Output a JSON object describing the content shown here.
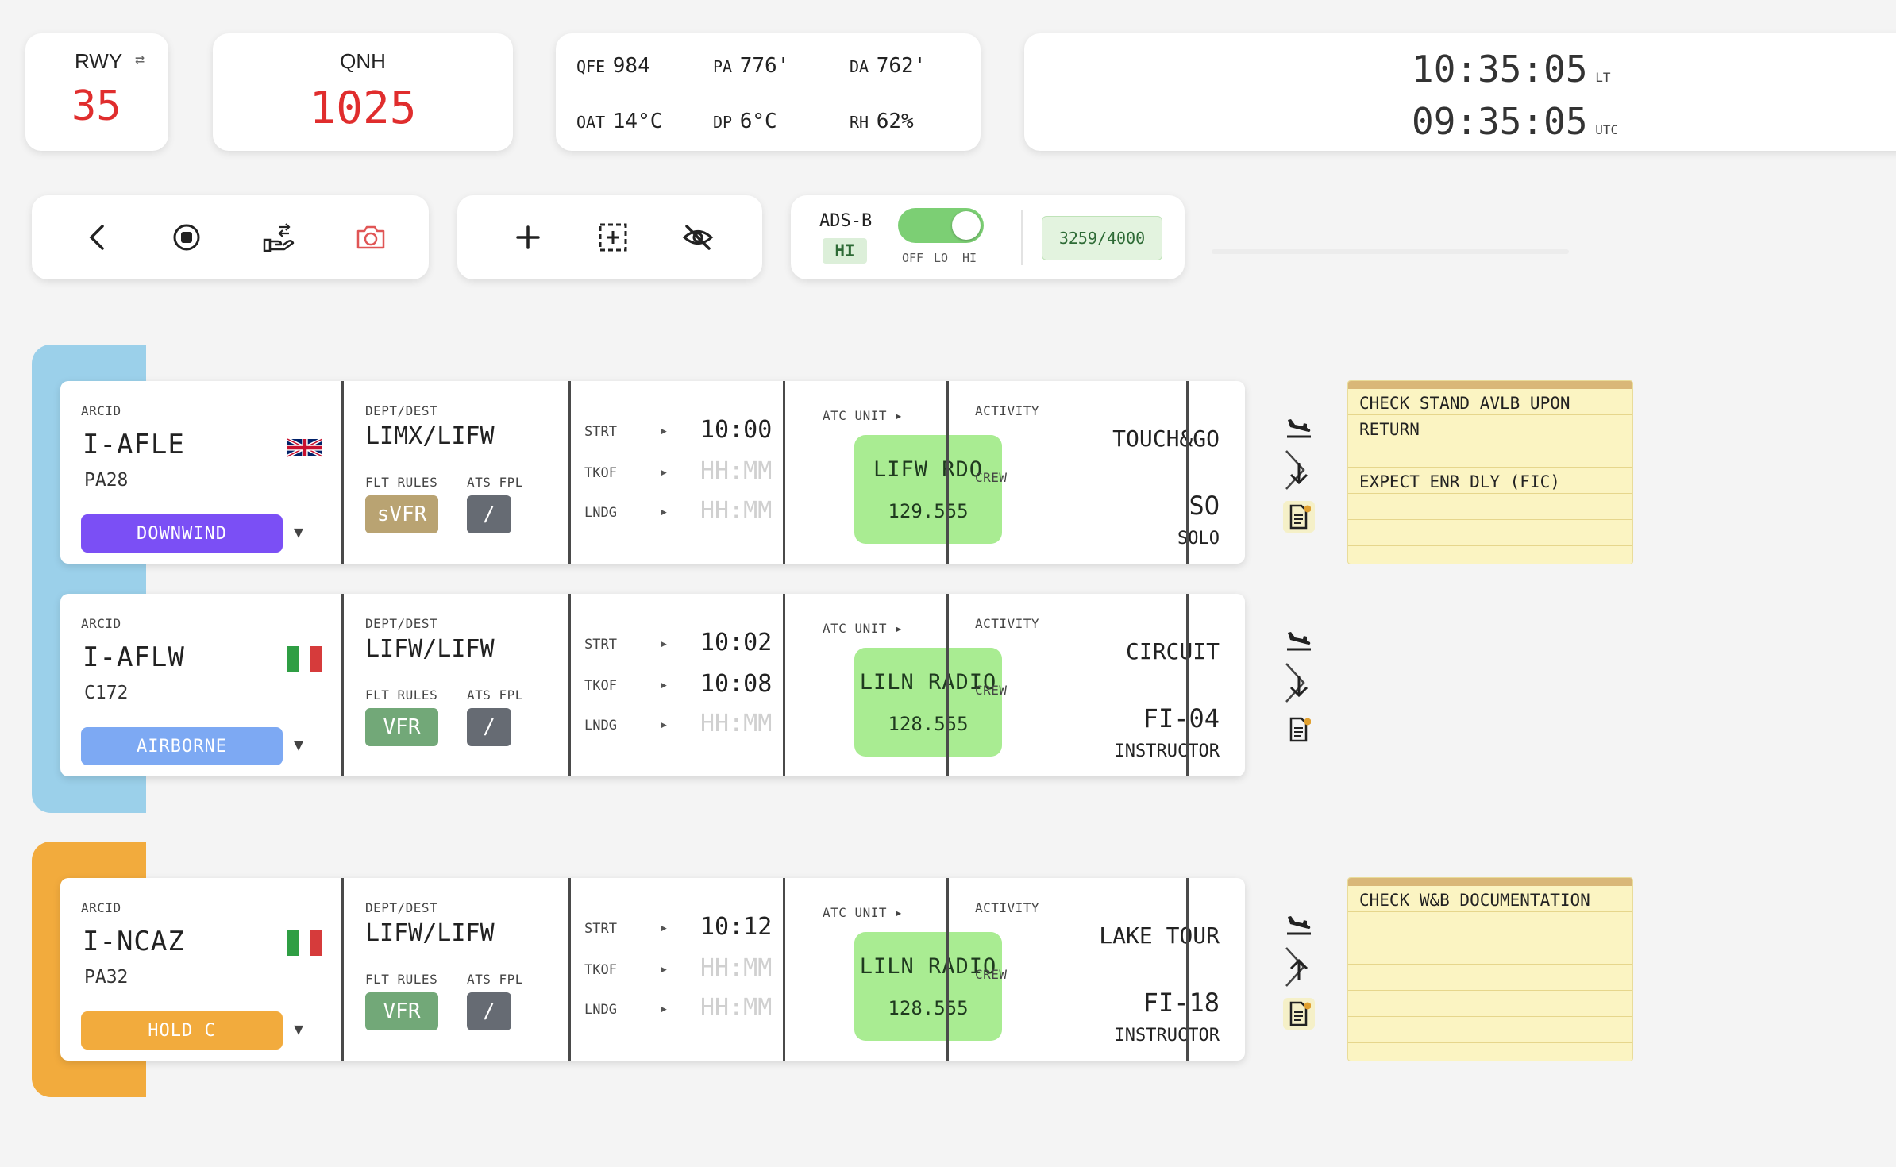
{
  "runway": {
    "label": "RWY",
    "swap_icon": "swap-arrows-icon",
    "value": "35"
  },
  "qnh": {
    "label": "QNH",
    "value": "1025"
  },
  "weather": [
    {
      "label": "QFE",
      "value": "984"
    },
    {
      "label": "PA",
      "value": "776'"
    },
    {
      "label": "DA",
      "value": "762'"
    },
    {
      "label": "OAT",
      "value": "14°C"
    },
    {
      "label": "DP",
      "value": "6°C"
    },
    {
      "label": "RH",
      "value": "62%"
    }
  ],
  "clock": {
    "local": "10:35:05",
    "local_suffix": "LT",
    "utc": "09:35:05",
    "utc_suffix": "UTC"
  },
  "toolbar": {
    "left_group": [
      "back-chevron-icon",
      "record-stop-icon",
      "handover-icon",
      "camera-icon"
    ],
    "mid_group": [
      "add-icon",
      "add-frame-icon",
      "hide-eye-icon"
    ]
  },
  "adsb": {
    "label": "ADS-B",
    "badge": "HI",
    "toggle_labels": [
      "OFF",
      "LO",
      "HI"
    ],
    "counter": "3259/4000"
  },
  "labels": {
    "arcid": "ARCID",
    "dept_dest": "DEPT/DEST",
    "flt_rules": "FLT RULES",
    "ats_fpl": "ATS FPL",
    "strt": "STRT",
    "tkof": "TKOF",
    "lndg": "LNDG",
    "atc_unit": "ATC UNIT ▸",
    "activity": "ACTIVITY",
    "crew": "CREW",
    "caret": "▼",
    "play": "▶"
  },
  "colors": {
    "group_blue": "#9bd0ea",
    "group_orange": "#f2ab3d",
    "downwind": "#7b4ff5",
    "airborne": "#7da9f3",
    "hold": "#f2ab3d",
    "svfr": "#b9a372",
    "vfr": "#72a878",
    "fpl": "#666b73",
    "atc_green": "#a9ec92"
  },
  "strips": [
    {
      "callsign": "I-AFLE",
      "flag": "uk-flag-icon",
      "actype": "PA28",
      "status": "DOWNWIND",
      "route": "LIMX/LIFW",
      "flt_rules": "sVFR",
      "ats_fpl": "/",
      "strt": "10:00",
      "tkof": "HH:MM",
      "lndg": "HH:MM",
      "atc_name": "LIFW RDO",
      "atc_freq": "129.555",
      "activity": "TOUCH&GO",
      "crew_code": "SO",
      "crew_role": "SOLO",
      "side_icons": [
        "landing-plane-icon",
        "arrow-down-icon",
        "note-icon"
      ],
      "note": [
        "CHECK STAND AVLB UPON",
        "RETURN",
        "",
        "EXPECT ENR DLY (FIC)",
        "",
        ""
      ]
    },
    {
      "callsign": "I-AFLW",
      "flag": "italy-flag-icon",
      "actype": "C172",
      "status": "AIRBORNE",
      "route": "LIFW/LIFW",
      "flt_rules": "VFR",
      "ats_fpl": "/",
      "strt": "10:02",
      "tkof": "10:08",
      "lndg": "HH:MM",
      "atc_name": "LILN RADIO",
      "atc_freq": "128.555",
      "activity": "CIRCUIT",
      "crew_code": "FI-04",
      "crew_role": "INSTRUCTOR",
      "side_icons": [
        "landing-plane-icon",
        "arrow-down-icon",
        "note-icon"
      ]
    },
    {
      "callsign": "I-NCAZ",
      "flag": "italy-flag-icon",
      "actype": "PA32",
      "status": "HOLD C",
      "route": "LIFW/LIFW",
      "flt_rules": "VFR",
      "ats_fpl": "/",
      "strt": "10:12",
      "tkof": "HH:MM",
      "lndg": "HH:MM",
      "atc_name": "LILN RADIO",
      "atc_freq": "128.555",
      "activity": "LAKE TOUR",
      "crew_code": "FI-18",
      "crew_role": "INSTRUCTOR",
      "side_icons": [
        "landing-plane-icon",
        "arrow-up-icon",
        "note-icon"
      ],
      "note": [
        "CHECK W&B DOCUMENTATION",
        "",
        "",
        "",
        "",
        ""
      ]
    }
  ]
}
